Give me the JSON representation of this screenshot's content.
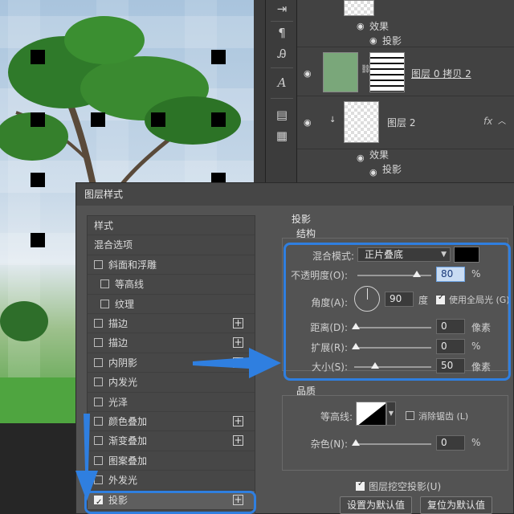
{
  "layers": {
    "items": [
      {
        "type": "effects-header",
        "label": "效果"
      },
      {
        "type": "effect",
        "label": "投影"
      },
      {
        "type": "layer",
        "name": "图层 0 拷贝 2"
      },
      {
        "type": "layer",
        "name": "图层 2",
        "fx": "fx"
      },
      {
        "type": "effects-header",
        "label": "效果"
      },
      {
        "type": "effect",
        "label": "投影"
      }
    ]
  },
  "dialog": {
    "title": "图层样式",
    "sidebar": [
      {
        "label": "样式",
        "checkbox": false,
        "plus": false
      },
      {
        "label": "混合选项",
        "checkbox": false,
        "plus": false
      },
      {
        "label": "斜面和浮雕",
        "checkbox": true,
        "checked": false,
        "plus": false
      },
      {
        "label": "等高线",
        "checkbox": true,
        "checked": false,
        "plus": false,
        "indent": true
      },
      {
        "label": "纹理",
        "checkbox": true,
        "checked": false,
        "plus": false,
        "indent": true
      },
      {
        "label": "描边",
        "checkbox": true,
        "checked": false,
        "plus": true
      },
      {
        "label": "描边",
        "checkbox": true,
        "checked": false,
        "plus": true
      },
      {
        "label": "内阴影",
        "checkbox": true,
        "checked": false,
        "plus": true
      },
      {
        "label": "内发光",
        "checkbox": true,
        "checked": false,
        "plus": false
      },
      {
        "label": "光泽",
        "checkbox": true,
        "checked": false,
        "plus": false
      },
      {
        "label": "颜色叠加",
        "checkbox": true,
        "checked": false,
        "plus": true
      },
      {
        "label": "渐变叠加",
        "checkbox": true,
        "checked": false,
        "plus": true
      },
      {
        "label": "图案叠加",
        "checkbox": true,
        "checked": false,
        "plus": false
      },
      {
        "label": "外发光",
        "checkbox": true,
        "checked": false,
        "plus": false
      },
      {
        "label": "投影",
        "checkbox": true,
        "checked": true,
        "plus": true
      }
    ],
    "section_title": "投影",
    "structure": {
      "title": "结构",
      "blend_mode_label": "混合模式:",
      "blend_mode_value": "正片叠底",
      "opacity_label": "不透明度(O):",
      "opacity_value": "80",
      "opacity_unit": "%",
      "opacity_level": 0.8,
      "angle_label": "角度(A):",
      "angle_value": "90",
      "angle_unit": "度",
      "global_light_label": "使用全局光 (G)",
      "global_light_checked": true,
      "distance_label": "距离(D):",
      "distance_value": "0",
      "distance_unit": "像素",
      "spread_label": "扩展(R):",
      "spread_value": "0",
      "spread_unit": "%",
      "size_label": "大小(S):",
      "size_value": "50",
      "size_unit": "像素"
    },
    "quality": {
      "title": "品质",
      "contour_label": "等高线:",
      "antialias_label": "消除锯齿 (L)",
      "noise_label": "杂色(N):",
      "noise_value": "0",
      "noise_unit": "%"
    },
    "knockout_label": "图层挖空投影(U)",
    "set_default_label": "设置为默认值",
    "reset_default_label": "复位为默认值"
  },
  "colors": {
    "highlight": "#2f7fe0",
    "shadow_color": "#000000"
  }
}
